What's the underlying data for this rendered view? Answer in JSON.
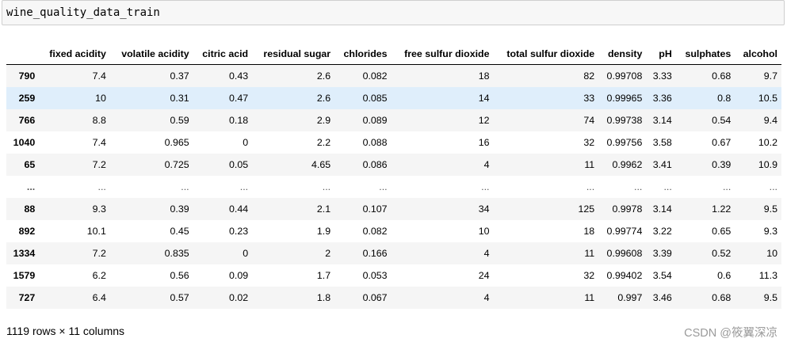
{
  "input": {
    "code": "wine_quality_data_train"
  },
  "table": {
    "columns": [
      "",
      "fixed acidity",
      "volatile acidity",
      "citric acid",
      "residual sugar",
      "chlorides",
      "free sulfur dioxide",
      "total sulfur dioxide",
      "density",
      "pH",
      "sulphates",
      "alcohol"
    ],
    "rows": [
      {
        "index": "790",
        "values": [
          "7.4",
          "0.37",
          "0.43",
          "2.6",
          "0.082",
          "18",
          "82",
          "0.99708",
          "3.33",
          "0.68",
          "9.7"
        ],
        "hovered": false
      },
      {
        "index": "259",
        "values": [
          "10",
          "0.31",
          "0.47",
          "2.6",
          "0.085",
          "14",
          "33",
          "0.99965",
          "3.36",
          "0.8",
          "10.5"
        ],
        "hovered": true
      },
      {
        "index": "766",
        "values": [
          "8.8",
          "0.59",
          "0.18",
          "2.9",
          "0.089",
          "12",
          "74",
          "0.99738",
          "3.14",
          "0.54",
          "9.4"
        ],
        "hovered": false
      },
      {
        "index": "1040",
        "values": [
          "7.4",
          "0.965",
          "0",
          "2.2",
          "0.088",
          "16",
          "32",
          "0.99756",
          "3.58",
          "0.67",
          "10.2"
        ],
        "hovered": false
      },
      {
        "index": "65",
        "values": [
          "7.2",
          "0.725",
          "0.05",
          "4.65",
          "0.086",
          "4",
          "11",
          "0.9962",
          "3.41",
          "0.39",
          "10.9"
        ],
        "hovered": false
      },
      {
        "index": "...",
        "values": [
          "...",
          "...",
          "...",
          "...",
          "...",
          "...",
          "...",
          "...",
          "...",
          "...",
          "..."
        ],
        "hovered": false
      },
      {
        "index": "88",
        "values": [
          "9.3",
          "0.39",
          "0.44",
          "2.1",
          "0.107",
          "34",
          "125",
          "0.9978",
          "3.14",
          "1.22",
          "9.5"
        ],
        "hovered": false
      },
      {
        "index": "892",
        "values": [
          "10.1",
          "0.45",
          "0.23",
          "1.9",
          "0.082",
          "10",
          "18",
          "0.99774",
          "3.22",
          "0.65",
          "9.3"
        ],
        "hovered": false
      },
      {
        "index": "1334",
        "values": [
          "7.2",
          "0.835",
          "0",
          "2",
          "0.166",
          "4",
          "11",
          "0.99608",
          "3.39",
          "0.52",
          "10"
        ],
        "hovered": false
      },
      {
        "index": "1579",
        "values": [
          "6.2",
          "0.56",
          "0.09",
          "1.7",
          "0.053",
          "24",
          "32",
          "0.99402",
          "3.54",
          "0.6",
          "11.3"
        ],
        "hovered": false
      },
      {
        "index": "727",
        "values": [
          "6.4",
          "0.57",
          "0.02",
          "1.8",
          "0.067",
          "4",
          "11",
          "0.997",
          "3.46",
          "0.68",
          "9.5"
        ],
        "hovered": false
      }
    ]
  },
  "footer": {
    "shape": "1119 rows × 11 columns"
  },
  "watermark": {
    "text": "CSDN @筱翼深凉"
  }
}
